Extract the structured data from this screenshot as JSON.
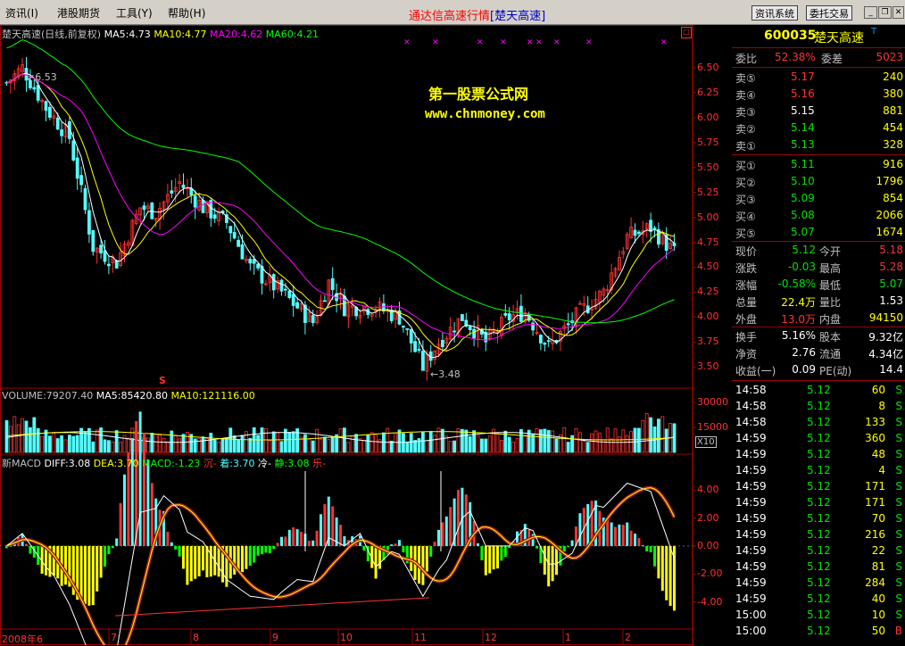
{
  "menu": {
    "items": [
      "资讯(I)",
      "港股期货",
      "工具(Y)",
      "帮助(H)"
    ],
    "title": "通达信高速行情",
    "title_stock": "[楚天高速]",
    "btn_info": "资讯系统",
    "btn_trade": "委托交易"
  },
  "colors": {
    "up": "#ff3232",
    "down": "#54fcfc",
    "ma5": "#ffffff",
    "ma10": "#ffff00",
    "ma20": "#ff00ff",
    "ma60": "#00ff00",
    "grid": "#a00000"
  },
  "kline": {
    "header": {
      "name": "楚天高速(日线,前复权)",
      "ma5": "MA5:4.73",
      "ma10": "MA10:4.77",
      "ma20": "MA20:4.62",
      "ma60": "MA60:4.21"
    },
    "yticks": [
      "6.50",
      "6.25",
      "6.00",
      "5.75",
      "5.50",
      "5.25",
      "5.00",
      "4.75",
      "4.50",
      "4.25",
      "4.00",
      "3.75",
      "3.50"
    ],
    "high_label": "6.53",
    "low_label": "3.48",
    "watermark1": "第一股票公式网",
    "watermark2": "www.chnmoney.com",
    "signal": "S"
  },
  "volume": {
    "header": {
      "vol": "VOLUME:79207.40",
      "ma5": "MA5:85420.80",
      "ma10": "MA10:121116.00"
    },
    "yticks": [
      "30000",
      "15000"
    ],
    "unit": "X10"
  },
  "macd": {
    "header": {
      "name": "新MACD",
      "diff": "DIFF:3.08",
      "dea": "DEA:3.70",
      "macd": "MACD:-1.23",
      "s1": "沉-",
      "s2": "着:3.70",
      "s3": "冷-",
      "s4": "静:3.08",
      "s5": "乐-"
    },
    "yticks": [
      "4.00",
      "2.00",
      "0.00",
      "-2.00",
      "-4.00"
    ]
  },
  "xaxis": {
    "labels": [
      "2008年6",
      "7",
      "8",
      "9",
      "10",
      "11",
      "12",
      "1",
      "2"
    ]
  },
  "chart_data": {
    "type": "candlestick",
    "price_range": [
      3.35,
      6.75
    ],
    "high": 6.53,
    "low": 3.48,
    "last_ma": {
      "MA5": 4.73,
      "MA10": 4.77,
      "MA20": 4.62,
      "MA60": 4.21
    },
    "volume_range": [
      0,
      36000
    ],
    "macd": {
      "DIFF": 3.08,
      "DEA": 3.7,
      "MACD": -1.23,
      "range": [
        -5.5,
        6
      ]
    }
  },
  "quote": {
    "code": "600035",
    "name": "楚天高速",
    "flag": "T",
    "weibi_label": "委比",
    "weibi": "52.38%",
    "weicha_label": "委差",
    "weicha": "5023",
    "sell": [
      {
        "l": "卖⑤",
        "p": "5.17",
        "v": "240"
      },
      {
        "l": "卖④",
        "p": "5.16",
        "v": "380"
      },
      {
        "l": "卖③",
        "p": "5.15",
        "v": "881"
      },
      {
        "l": "卖②",
        "p": "5.14",
        "v": "454"
      },
      {
        "l": "卖①",
        "p": "5.13",
        "v": "328"
      }
    ],
    "buy": [
      {
        "l": "买①",
        "p": "5.11",
        "v": "916"
      },
      {
        "l": "买②",
        "p": "5.10",
        "v": "1796"
      },
      {
        "l": "买③",
        "p": "5.09",
        "v": "854"
      },
      {
        "l": "买④",
        "p": "5.08",
        "v": "2066"
      },
      {
        "l": "买⑤",
        "p": "5.07",
        "v": "1674"
      }
    ],
    "stats": [
      {
        "l1": "现价",
        "v1": "5.12",
        "l2": "今开",
        "v2": "5.18"
      },
      {
        "l1": "涨跌",
        "v1": "-0.03",
        "l2": "最高",
        "v2": "5.28"
      },
      {
        "l1": "涨幅",
        "v1": "-0.58%",
        "l2": "最低",
        "v2": "5.07"
      },
      {
        "l1": "总量",
        "v1": "22.4万",
        "l2": "量比",
        "v2": "1.53"
      },
      {
        "l1": "外盘",
        "v1": "13.0万",
        "l2": "内盘",
        "v2": "94150"
      }
    ],
    "fin": [
      {
        "l1": "换手",
        "v1": "5.16%",
        "l2": "股本",
        "v2": "9.32亿"
      },
      {
        "l1": "净资",
        "v1": "2.76",
        "l2": "流通",
        "v2": "4.34亿"
      },
      {
        "l1": "收益(一)",
        "v1": "0.09",
        "l2": "PE(动)",
        "v2": "14.4"
      }
    ],
    "ticks": [
      {
        "t": "14:58",
        "p": "5.12",
        "v": "60",
        "s": "S"
      },
      {
        "t": "14:58",
        "p": "5.12",
        "v": "8",
        "s": "S"
      },
      {
        "t": "14:58",
        "p": "5.12",
        "v": "133",
        "s": "S"
      },
      {
        "t": "14:59",
        "p": "5.12",
        "v": "360",
        "s": "S"
      },
      {
        "t": "14:59",
        "p": "5.12",
        "v": "48",
        "s": "S"
      },
      {
        "t": "14:59",
        "p": "5.12",
        "v": "4",
        "s": "S"
      },
      {
        "t": "14:59",
        "p": "5.12",
        "v": "171",
        "s": "S"
      },
      {
        "t": "14:59",
        "p": "5.12",
        "v": "171",
        "s": "S"
      },
      {
        "t": "14:59",
        "p": "5.12",
        "v": "70",
        "s": "S"
      },
      {
        "t": "14:59",
        "p": "5.12",
        "v": "216",
        "s": "S"
      },
      {
        "t": "14:59",
        "p": "5.12",
        "v": "22",
        "s": "S"
      },
      {
        "t": "14:59",
        "p": "5.12",
        "v": "81",
        "s": "S"
      },
      {
        "t": "14:59",
        "p": "5.12",
        "v": "284",
        "s": "S"
      },
      {
        "t": "14:59",
        "p": "5.12",
        "v": "40",
        "s": "S"
      },
      {
        "t": "15:00",
        "p": "5.12",
        "v": "10",
        "s": "S"
      },
      {
        "t": "15:00",
        "p": "5.12",
        "v": "50",
        "s": "B"
      }
    ]
  }
}
